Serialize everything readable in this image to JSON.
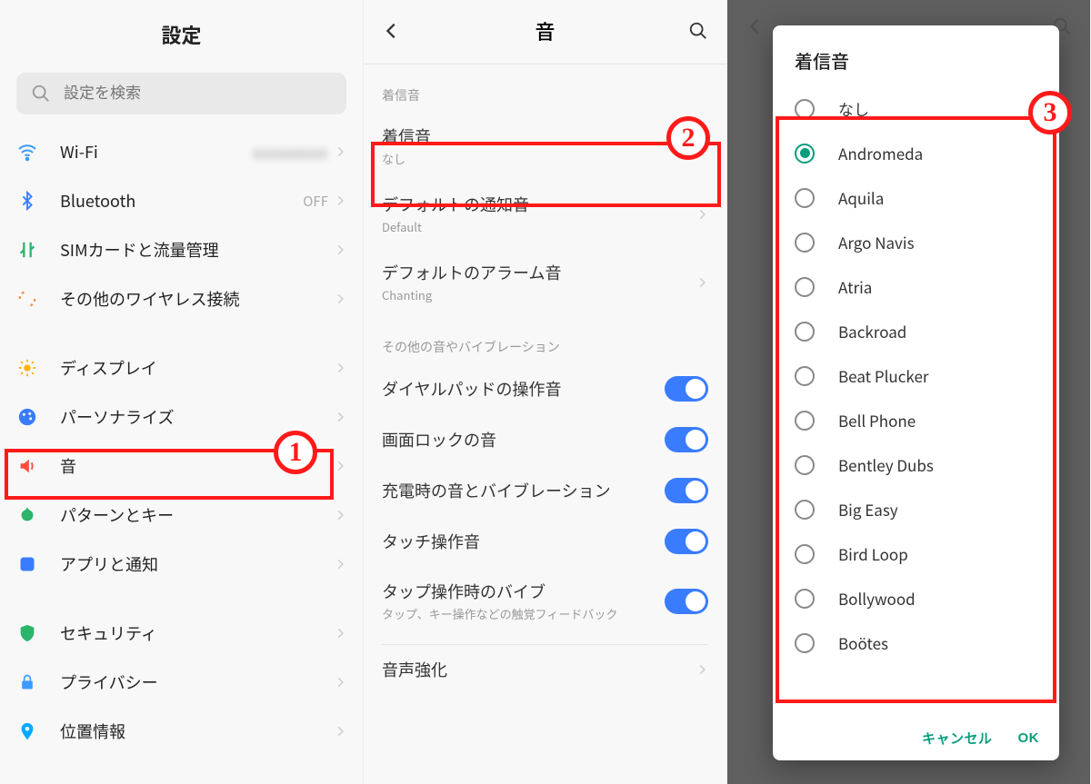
{
  "colors": {
    "accent_blue": "#3a7cff",
    "accent_teal": "#0a9d7d",
    "annotation_red": "#ff1a1a"
  },
  "annotations": {
    "badge1": "1",
    "badge2": "2",
    "badge3": "3"
  },
  "panel1": {
    "title": "設定",
    "search_placeholder": "設定を検索",
    "items_group1": [
      {
        "icon": "wifi-icon",
        "color": "#3a9bff",
        "label": "Wi-Fi",
        "value_blurred": true
      },
      {
        "icon": "bluetooth-icon",
        "color": "#3a7cff",
        "label": "Bluetooth",
        "value": "OFF"
      },
      {
        "icon": "sim-icon",
        "color": "#2ab56a",
        "label": "SIMカードと流量管理"
      },
      {
        "icon": "wireless-icon",
        "color": "#ff8a3d",
        "label": "その他のワイヤレス接続"
      }
    ],
    "items_group2": [
      {
        "icon": "display-icon",
        "color": "#ffb300",
        "label": "ディスプレイ"
      },
      {
        "icon": "personalize-icon",
        "color": "#3a7cff",
        "label": "パーソナライズ"
      },
      {
        "icon": "sound-icon",
        "color": "#ff4d3a",
        "label": "音"
      },
      {
        "icon": "patterns-icon",
        "color": "#2ab56a",
        "label": "パターンとキー"
      },
      {
        "icon": "apps-icon",
        "color": "#3a7cff",
        "label": "アプリと通知"
      }
    ],
    "items_group3": [
      {
        "icon": "security-icon",
        "color": "#2ab56a",
        "label": "セキュリティ"
      },
      {
        "icon": "privacy-icon",
        "color": "#3a9bff",
        "label": "プライバシー"
      },
      {
        "icon": "location-icon",
        "color": "#00aaff",
        "label": "位置情報"
      }
    ]
  },
  "panel2": {
    "title": "音",
    "section1": "着信音",
    "rows1": [
      {
        "label": "着信音",
        "sub": "なし"
      },
      {
        "label": "デフォルトの通知音",
        "sub": "Default"
      },
      {
        "label": "デフォルトのアラーム音",
        "sub": "Chanting"
      }
    ],
    "section2": "その他の音やバイブレーション",
    "rows2": [
      {
        "label": "ダイヤルパッドの操作音",
        "toggle": true
      },
      {
        "label": "画面ロックの音",
        "toggle": true
      },
      {
        "label": "充電時の音とバイブレーション",
        "toggle": true
      },
      {
        "label": "タッチ操作音",
        "toggle": true
      },
      {
        "label": "タップ操作時のバイブ",
        "sub": "タップ、キー操作などの触覚フィードバック",
        "toggle": true
      }
    ],
    "row_last": {
      "label": "音声強化"
    }
  },
  "panel3": {
    "dialog_title": "着信音",
    "selected_index": 1,
    "options": [
      "なし",
      "Andromeda",
      "Aquila",
      "Argo Navis",
      "Atria",
      "Backroad",
      "Beat Plucker",
      "Bell Phone",
      "Bentley Dubs",
      "Big Easy",
      "Bird Loop",
      "Bollywood",
      "Boötes"
    ],
    "cancel": "キャンセル",
    "ok": "OK"
  }
}
